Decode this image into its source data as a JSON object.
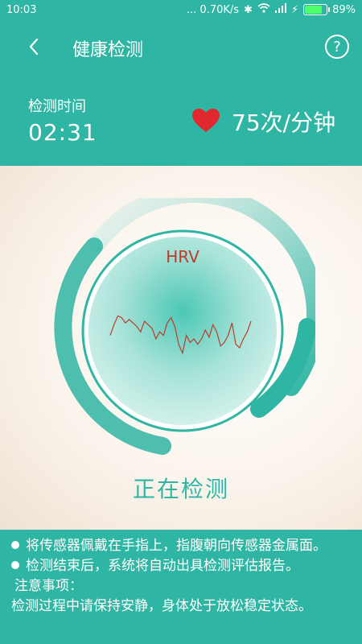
{
  "status_bar": {
    "time": "10:03",
    "net": "... 0.70K/s",
    "battery": "89%",
    "battery_level": 0.89
  },
  "app_bar": {
    "title": "健康检测"
  },
  "detection": {
    "time_label": "检测时间",
    "time_value": "02:31",
    "heart_rate": "75次/分钟"
  },
  "hrv": {
    "label": "HRV",
    "values": [
      2,
      8,
      13,
      12,
      9,
      11,
      9,
      7,
      4,
      10,
      8,
      6,
      0,
      4,
      2,
      9,
      12,
      7,
      -3,
      -8,
      2,
      -2,
      0,
      -3,
      0,
      5,
      1,
      8,
      4,
      -4,
      -2,
      2,
      9,
      -3,
      -5,
      0,
      4,
      10
    ]
  },
  "status": "正在检测",
  "notes": {
    "line1": "将传感器佩戴在手指上，指腹朝向传感器金属面。",
    "line2": "检测结束后，系统将自动出具检测评估报告。",
    "line3": "注意事项：",
    "line4": "检测过程中请保持安静，身体处于放松稳定状态。"
  },
  "colors": {
    "accent": "#2fb5a3",
    "heart": "#e0292e",
    "hrv_line": "#c0392b"
  }
}
